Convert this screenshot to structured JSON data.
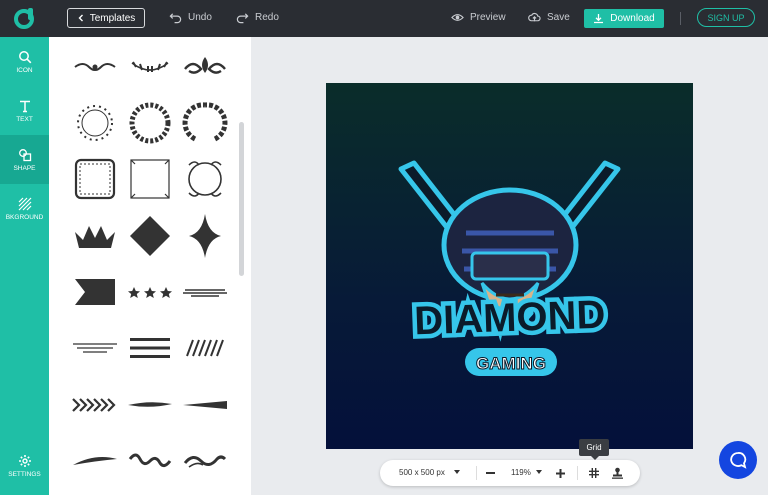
{
  "topbar": {
    "templates_label": "Templates",
    "undo_label": "Undo",
    "redo_label": "Redo",
    "preview_label": "Preview",
    "save_label": "Save",
    "download_label": "Download",
    "signup_label": "SIGN UP"
  },
  "rail": {
    "icon_label": "ICON",
    "text_label": "TEXT",
    "shape_label": "SHAPE",
    "background_label": "BKGROUND",
    "settings_label": "SETTINGS"
  },
  "canvas": {
    "title": "DIAMOND",
    "subtitle": "GAMING"
  },
  "bottombar": {
    "size_label": "500 x 500 px",
    "zoom_label": "119%",
    "grid_tooltip": "Grid"
  },
  "colors": {
    "accent": "#1fbfa6",
    "topbar": "#2a2d33",
    "chat": "#1446e0"
  }
}
